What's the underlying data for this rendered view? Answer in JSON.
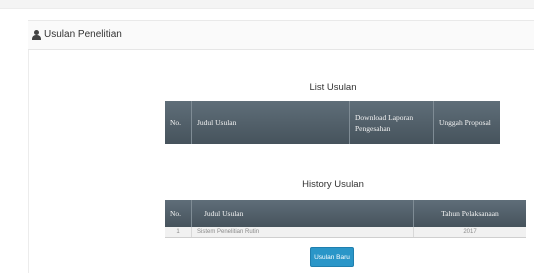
{
  "panel": {
    "title": "Usulan Penelitian"
  },
  "list_usulan": {
    "title": "List Usulan",
    "headers": [
      "No.",
      "Judul Usulan",
      "Download Laporan Pengesahan",
      "Unggah Proposal"
    ]
  },
  "history_usulan": {
    "title": "History Usulan",
    "headers": [
      "No.",
      "Judul Usulan",
      "Tahun Pelaksanaan"
    ],
    "rows": [
      [
        "1",
        "Sistem Penelitian Rutin",
        "2017"
      ]
    ]
  },
  "buttons": {
    "new_label": "Usulan Baru"
  }
}
